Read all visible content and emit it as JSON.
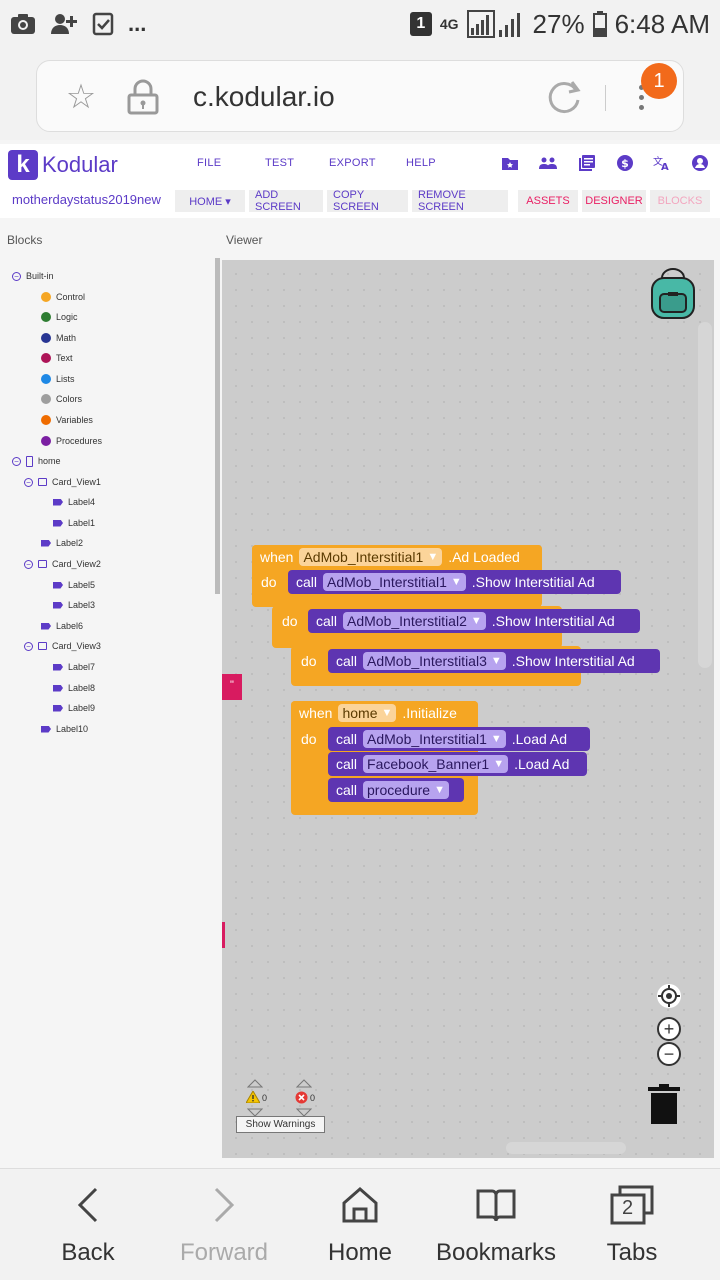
{
  "statusbar": {
    "sim": "1",
    "network": "4G",
    "battery": "27%",
    "time": "6:48 AM",
    "icons": [
      "camera-icon",
      "add-user-icon",
      "checkbox-icon",
      "more-icon",
      "signal-icon",
      "battery-icon"
    ],
    "more": "..."
  },
  "browser": {
    "url": "c.kodular.io",
    "notification_count": "1"
  },
  "kodular": {
    "brand": "Kodular",
    "logo_letter": "k",
    "menu": {
      "file": "FILE",
      "test": "TEST",
      "export": "EXPORT",
      "help": "HELP"
    },
    "project": "motherdaystatus2019new",
    "screen_select": "HOME ▾",
    "buttons": {
      "add_screen": "ADD SCREEN",
      "copy_screen": "COPY SCREEN",
      "remove_screen": "REMOVE SCREEN",
      "assets": "ASSETS",
      "designer": "DESIGNER",
      "blocks": "BLOCKS"
    },
    "accent": "#5c3bc7",
    "pink": "#e91e63"
  },
  "panels": {
    "blocks": "Blocks",
    "viewer": "Viewer"
  },
  "tree": {
    "builtin": "Built-in",
    "builtins": [
      {
        "label": "Control",
        "color": "#f5a623"
      },
      {
        "label": "Logic",
        "color": "#2e7d32"
      },
      {
        "label": "Math",
        "color": "#283593"
      },
      {
        "label": "Text",
        "color": "#ad1457"
      },
      {
        "label": "Lists",
        "color": "#1e88e5"
      },
      {
        "label": "Colors",
        "color": "#9e9e9e"
      },
      {
        "label": "Variables",
        "color": "#ef6c00"
      },
      {
        "label": "Procedures",
        "color": "#7b1fa2"
      }
    ],
    "home": "home",
    "components": {
      "card1": "Card_View1",
      "label4": "Label4",
      "label1": "Label1",
      "label2": "Label2",
      "card2": "Card_View2",
      "label5": "Label5",
      "label3": "Label3",
      "label6": "Label6",
      "card3": "Card_View3",
      "label7": "Label7",
      "label8": "Label8",
      "label9": "Label9",
      "label10": "Label10"
    }
  },
  "blocks": {
    "when": "when",
    "do": "do",
    "call": "call",
    "event1": {
      "component": "AdMob_Interstitial1",
      "event": ".Ad Loaded"
    },
    "call1": {
      "component": "AdMob_Interstitial1",
      "method": ".Show Interstitial Ad"
    },
    "call2": {
      "component": "AdMob_Interstitial2",
      "method": ".Show Interstitial Ad"
    },
    "call3": {
      "component": "AdMob_Interstitial3",
      "method": ".Show Interstitial Ad"
    },
    "event2": {
      "component": "home",
      "event": ".Initialize"
    },
    "call4": {
      "component": "AdMob_Interstitial1",
      "method": ".Load Ad"
    },
    "call5": {
      "component": "Facebook_Banner1",
      "method": ".Load Ad"
    },
    "call6": {
      "component": "procedure"
    },
    "quote": "\""
  },
  "viewer": {
    "warnings_count": "0",
    "errors_count": "0",
    "show_warnings": "Show Warnings"
  },
  "bottomnav": {
    "back": "Back",
    "forward": "Forward",
    "home": "Home",
    "bookmarks": "Bookmarks",
    "tabs": "Tabs",
    "tabs_count": "2"
  }
}
